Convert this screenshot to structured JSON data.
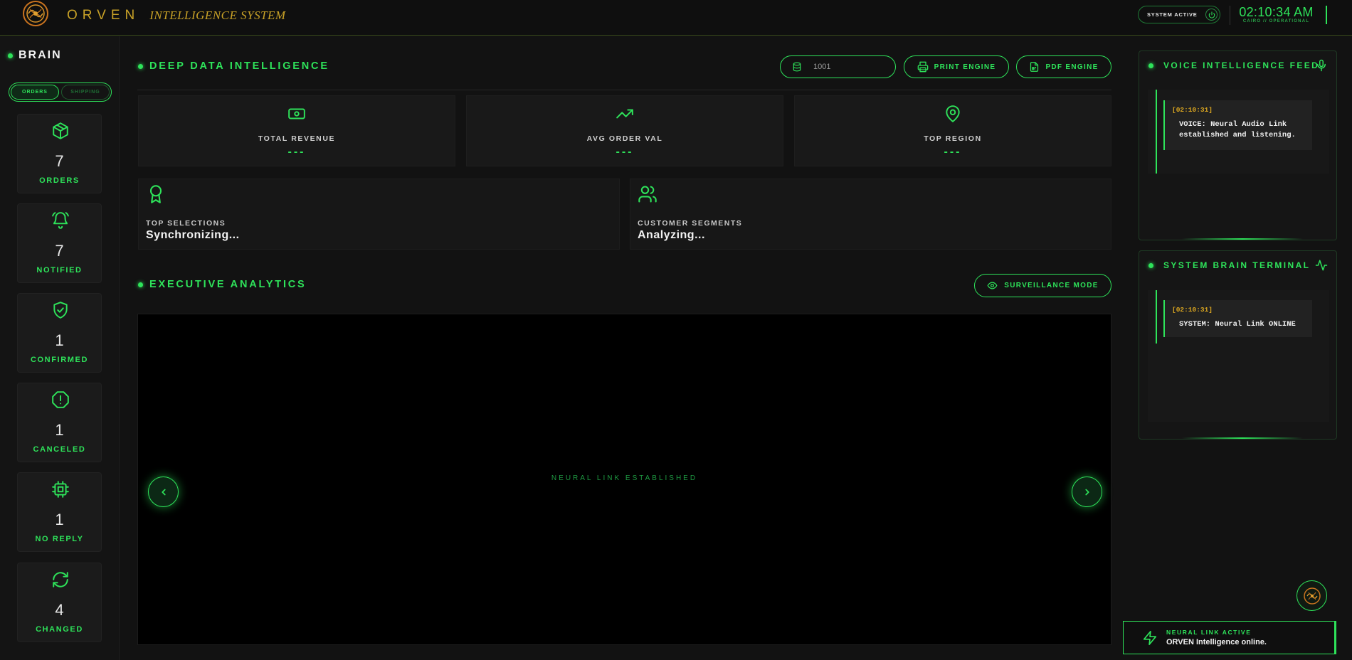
{
  "header": {
    "brand_name": "ORVEN",
    "brand_subtitle": "INTELLIGENCE SYSTEM",
    "status_label": "SYSTEM ACTIVE",
    "clock_time": "02:10:34 AM",
    "clock_location": "CAIRO // OPERATIONAL"
  },
  "sidebar": {
    "title": "BRAIN",
    "tabs": [
      {
        "label": "ORDERS",
        "active": true
      },
      {
        "label": "SHIPPING",
        "active": false
      }
    ],
    "stats": [
      {
        "value": "7",
        "label": "ORDERS",
        "icon": "box-icon"
      },
      {
        "value": "7",
        "label": "NOTIFIED",
        "icon": "bell-icon"
      },
      {
        "value": "1",
        "label": "CONFIRMED",
        "icon": "shield-check-icon"
      },
      {
        "value": "1",
        "label": "CANCELED",
        "icon": "alert-octagon-icon"
      },
      {
        "value": "1",
        "label": "NO REPLY",
        "icon": "cpu-icon"
      },
      {
        "value": "4",
        "label": "CHANGED",
        "icon": "refresh-icon"
      }
    ]
  },
  "deep_data": {
    "title": "DEEP DATA INTELLIGENCE",
    "search_value": "1001",
    "print_label": "PRINT ENGINE",
    "pdf_label": "PDF ENGINE",
    "kpis": [
      {
        "label": "TOTAL REVENUE",
        "value": "---",
        "icon": "banknote-icon"
      },
      {
        "label": "AVG ORDER VAL",
        "value": "---",
        "icon": "trending-up-icon"
      },
      {
        "label": "TOP REGION",
        "value": "---",
        "icon": "map-pin-icon"
      }
    ],
    "insights": [
      {
        "label": "TOP SELECTIONS",
        "value": "Synchronizing...",
        "icon": "award-icon"
      },
      {
        "label": "CUSTOMER SEGMENTS",
        "value": "Analyzing...",
        "icon": "users-icon"
      }
    ]
  },
  "executive": {
    "title": "EXECUTIVE ANALYTICS",
    "surveillance_label": "SURVEILLANCE MODE",
    "viewer_text": "NEURAL LINK ESTABLISHED"
  },
  "voice_feed": {
    "title": "VOICE INTELLIGENCE FEED",
    "entries": [
      {
        "time": "[02:10:31]",
        "text": "VOICE: Neural Audio Link established and listening."
      }
    ]
  },
  "terminal": {
    "title": "SYSTEM BRAIN TERMINAL",
    "entries": [
      {
        "time": "[02:10:31]",
        "text": "SYSTEM: Neural Link ONLINE"
      }
    ]
  },
  "toast": {
    "title": "NEURAL LINK ACTIVE",
    "message": "ORVEN Intelligence online."
  },
  "colors": {
    "accent": "#2ee35a",
    "gold": "#c9a227",
    "background": "#121212"
  }
}
